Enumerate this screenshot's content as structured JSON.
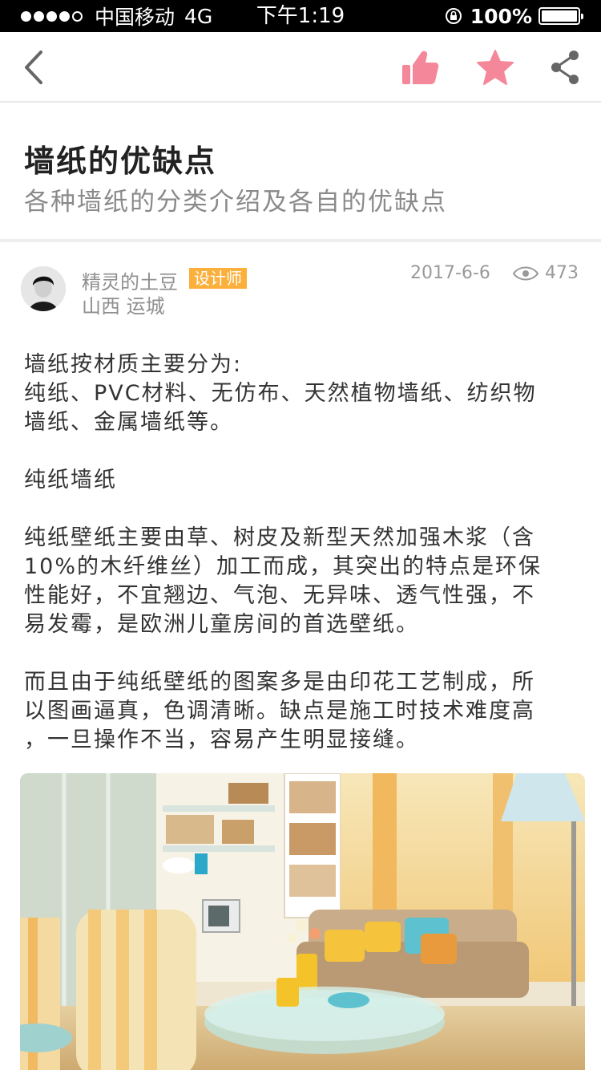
{
  "status_bar": {
    "carrier": "中国移动",
    "network": "4G",
    "time": "下午1:19",
    "battery": "100%",
    "signal_bars": 4
  },
  "nav": {
    "back_icon": "chevron-left-icon",
    "like_icon": "thumbs-up-icon",
    "favorite_icon": "star-icon",
    "share_icon": "share-icon",
    "accent_color": "#f4879a"
  },
  "article": {
    "title": "墙纸的优缺点",
    "subtitle": "各种墙纸的分类介绍及各自的优缺点"
  },
  "author": {
    "name": "精灵的土豆",
    "badge": "设计师",
    "badge_color": "#fbb03b",
    "location": "山西   运城",
    "date": "2017-6-6",
    "views": "473"
  },
  "content": {
    "p1": "墙纸按材质主要分为:\n纯纸、PVC材料、无仿布、天然植物墙纸、纺织物\n墙纸、金属墙纸等。",
    "p2": "纯纸墙纸",
    "p3": "纯纸壁纸主要由草、树皮及新型天然加强木浆（含\n10%的木纤维丝）加工而成，其突出的特点是环保\n性能好，不宜翘边、气泡、无异味、透气性强，不\n易发霉，是欧洲儿童房间的首选壁纸。",
    "p4": "而且由于纯纸壁纸的图案多是由印花工艺制成，所\n以图画逼真，色调清晰。缺点是施工时技术难度高\n，一旦操作不当，容易产生明显接缝。"
  }
}
